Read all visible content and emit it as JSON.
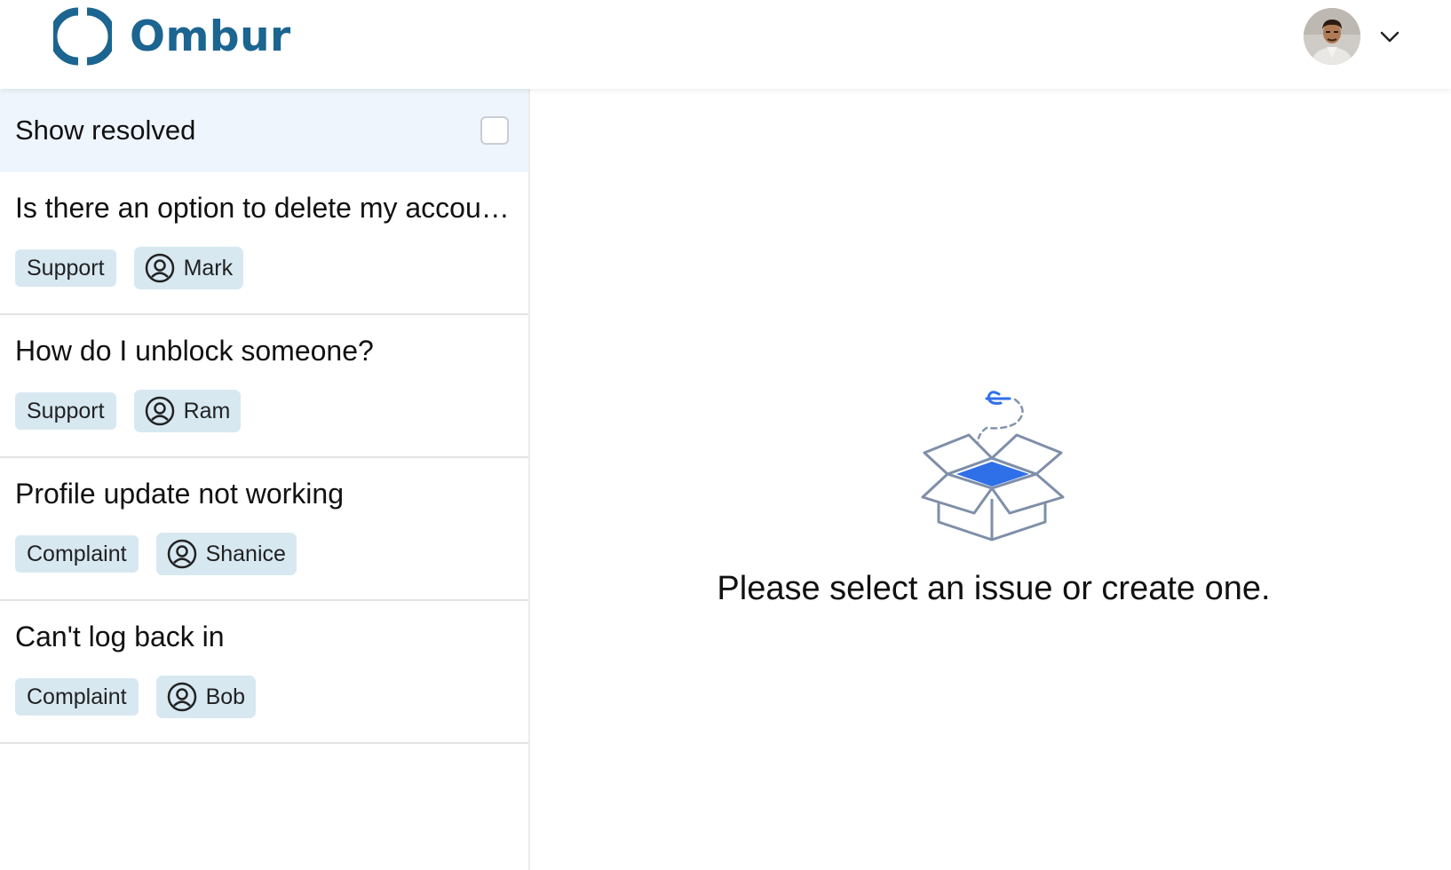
{
  "header": {
    "brand_name": "Ombur",
    "logo_icon": "ombur-logo-icon",
    "avatar_icon": "user-avatar-photo",
    "menu_icon": "chevron-down-icon",
    "brand_color": "#1b6590"
  },
  "sidebar": {
    "filter": {
      "label": "Show resolved",
      "checked": false
    },
    "issues": [
      {
        "title": "Is there an option to delete my account?",
        "category": "Support",
        "assignee": "Mark"
      },
      {
        "title": "How do I unblock someone?",
        "category": "Support",
        "assignee": "Ram"
      },
      {
        "title": "Profile update not working",
        "category": "Complaint",
        "assignee": "Shanice"
      },
      {
        "title": "Can't log back in",
        "category": "Complaint",
        "assignee": "Bob"
      }
    ]
  },
  "main": {
    "empty_message": "Please select an issue or create one.",
    "illustration_icon": "open-box-icon",
    "accent_color": "#2f6fe8"
  }
}
